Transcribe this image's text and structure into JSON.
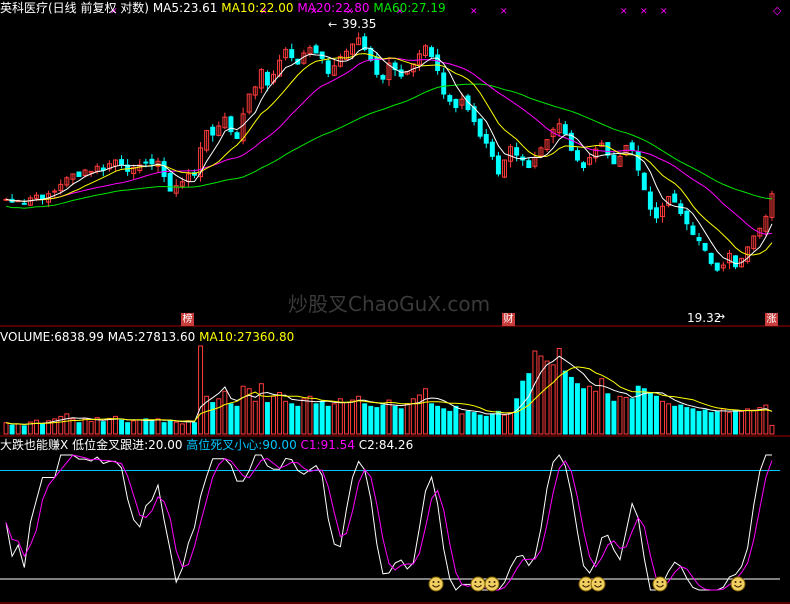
{
  "chart_data": [
    {
      "type": "candlestick",
      "title": "英科医疗(日线 前复权 对数)",
      "indicators": [
        {
          "label": "MA5:",
          "value": "23.61",
          "color": "#ffffff"
        },
        {
          "label": "MA10:",
          "value": "22.00",
          "color": "#ffff00"
        },
        {
          "label": "MA20:",
          "value": "22.80",
          "color": "#ff00ff"
        },
        {
          "label": "MA60:",
          "value": "27.19",
          "color": "#00e600"
        }
      ],
      "annotations": {
        "high": "39.35",
        "low": "19.32"
      },
      "markers": {
        "left": "榜",
        "mid": "财",
        "right": "涨"
      },
      "watermark": "炒股叉ChaoGuX.com",
      "ylim": [
        17,
        42
      ],
      "n": 127,
      "closes": [
        24.2,
        24.0,
        24.1,
        23.9,
        24.3,
        24.5,
        24.2,
        24.6,
        24.8,
        25.3,
        25.8,
        26.1,
        25.9,
        26.4,
        26.3,
        26.7,
        26.4,
        26.9,
        27.2,
        26.8,
        26.3,
        26.6,
        26.8,
        27.0,
        26.9,
        27.1,
        25.9,
        24.8,
        25.2,
        25.5,
        26.1,
        26.0,
        28.2,
        29.7,
        29.3,
        30.1,
        30.9,
        29.6,
        29.0,
        31.2,
        33.1,
        33.8,
        35.6,
        34.0,
        35.1,
        36.6,
        37.8,
        36.9,
        36.2,
        37.4,
        38.0,
        37.4,
        36.8,
        35.2,
        36.0,
        37.0,
        37.6,
        38.4,
        39.1,
        37.8,
        36.6,
        35.1,
        34.6,
        36.3,
        35.6,
        34.9,
        35.4,
        36.2,
        37.3,
        38.2,
        37.0,
        35.5,
        33.1,
        32.4,
        31.8,
        32.6,
        31.6,
        30.5,
        29.2,
        28.6,
        27.5,
        26.1,
        27.2,
        28.3,
        27.6,
        27.2,
        26.6,
        27.4,
        28.2,
        28.9,
        29.8,
        30.3,
        29.4,
        28.0,
        27.2,
        26.6,
        27.4,
        28.1,
        28.6,
        27.6,
        26.9,
        27.5,
        28.4,
        28.0,
        26.4,
        24.9,
        23.5,
        22.9,
        23.7,
        24.4,
        24.0,
        23.2,
        22.5,
        21.8,
        21.4,
        20.8,
        20.0,
        19.6,
        19.9,
        20.6,
        19.8,
        20.3,
        21.0,
        21.7,
        22.2,
        23.0,
        24.6
      ],
      "ma60_color": "#00e600",
      "ma20_color": "#ff00ff",
      "ma10_color": "#ffff00",
      "ma5_color": "#ffffff"
    },
    {
      "type": "bar",
      "title": "VOLUME",
      "indicators": [
        {
          "label": "VOLUME:",
          "value": "6838.99",
          "color": "#ffffff"
        },
        {
          "label": "MA5:",
          "value": "27813.60",
          "color": "#ffffff"
        },
        {
          "label": "MA10:",
          "value": "27360.80",
          "color": "#ffff00"
        }
      ],
      "ylim": [
        0,
        70000
      ],
      "volumes": [
        9000,
        7000,
        8000,
        6500,
        9500,
        11000,
        8000,
        10500,
        12000,
        14000,
        16000,
        12000,
        9000,
        12500,
        10000,
        13000,
        9800,
        12400,
        14000,
        11000,
        9000,
        10500,
        11200,
        12000,
        10800,
        12000,
        9000,
        11000,
        9500,
        8000,
        10500,
        9000,
        70000,
        30000,
        25000,
        28000,
        34000,
        24000,
        22000,
        38000,
        36000,
        26000,
        40000,
        25000,
        30000,
        33000,
        26000,
        24000,
        22000,
        28000,
        30000,
        24000,
        26000,
        22000,
        24000,
        28000,
        25000,
        27000,
        30000,
        24000,
        22000,
        21000,
        23000,
        27000,
        22000,
        20000,
        24000,
        28000,
        31000,
        36000,
        24000,
        22000,
        20000,
        18000,
        22000,
        16000,
        18000,
        17000,
        15000,
        14000,
        16000,
        18000,
        15000,
        17000,
        28000,
        42000,
        48000,
        66000,
        62000,
        58000,
        55000,
        68000,
        50000,
        45000,
        40000,
        36000,
        38000,
        34000,
        44000,
        32000,
        26000,
        30000,
        29000,
        28000,
        38000,
        36000,
        33000,
        30000,
        26000,
        24000,
        22000,
        23000,
        21000,
        20000,
        18000,
        19000,
        17000,
        18000,
        20000,
        17000,
        19000,
        18000,
        20000,
        19000,
        21000,
        23000,
        6838.99
      ]
    },
    {
      "type": "line",
      "title": "大跌也能赚X",
      "indicators": [
        {
          "label": "大跌也能赚X",
          "value": "",
          "color": "#ffffff"
        },
        {
          "label": "低位金叉跟进:",
          "value": "20.00",
          "color": "#ffffff"
        },
        {
          "label": "高位死叉小心:",
          "value": "90.00",
          "color": "#00c8ff"
        },
        {
          "label": "C1:",
          "value": "91.54",
          "color": "#ff00ff"
        },
        {
          "label": "C2:",
          "value": "84.26",
          "color": "#ffffff"
        }
      ],
      "ylim": [
        0,
        100
      ],
      "lines": {
        "high": 90,
        "low": 20
      }
    }
  ]
}
